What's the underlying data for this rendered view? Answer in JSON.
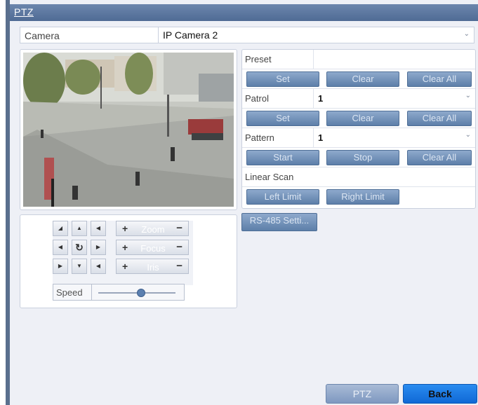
{
  "window": {
    "title": "PTZ"
  },
  "camera": {
    "label": "Camera",
    "value": "IP Camera 2"
  },
  "presets": {
    "preset_label": "Preset",
    "set_label": "Set",
    "clear_label": "Clear",
    "clear_all_label": "Clear All"
  },
  "patrol": {
    "label": "Patrol",
    "value": "1",
    "set_label": "Set",
    "clear_label": "Clear",
    "clear_all_label": "Clear All"
  },
  "pattern": {
    "label": "Pattern",
    "value": "1",
    "start_label": "Start",
    "stop_label": "Stop",
    "clear_all_label": "Clear All"
  },
  "linear_scan": {
    "label": "Linear Scan",
    "left_limit_label": "Left Limit",
    "right_limit_label": "Right Limit"
  },
  "rs485": {
    "label": "RS-485 Setti..."
  },
  "controls": {
    "zoom_label": "Zoom",
    "focus_label": "Focus",
    "iris_label": "Iris",
    "plus": "+",
    "minus": "−",
    "speed_label": "Speed",
    "speed_level": 0.55
  },
  "footer": {
    "ptz_label": "PTZ",
    "back_label": "Back"
  },
  "colors": {
    "title_bar": "#5a74a0",
    "button": "#7492bb",
    "back_button": "#1a7be8",
    "panel_bg": "#eef0f6"
  },
  "icons": {
    "camera_dropdown": "chevron-down-icon",
    "center": "refresh-icon",
    "arrows": [
      "up-left-icon",
      "up-icon",
      "up-right-icon",
      "left-icon",
      "right-icon",
      "down-left-icon",
      "down-icon",
      "down-right-icon"
    ]
  }
}
